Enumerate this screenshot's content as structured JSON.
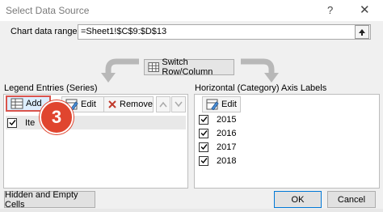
{
  "window": {
    "title": "Select Data Source",
    "help_glyph": "?",
    "close_glyph": "✕"
  },
  "range": {
    "label": "Chart data range:",
    "value": "=Sheet1!$C$9:$D$13"
  },
  "switch_label": "Switch Row/Column",
  "legend": {
    "title": "Legend Entries (Series)",
    "add_label": "Add",
    "edit_label": "Edit",
    "remove_label": "Remove",
    "items": [
      {
        "label": "Ite",
        "checked": true
      }
    ]
  },
  "axis": {
    "title": "Horizontal (Category) Axis Labels",
    "edit_label": "Edit",
    "items": [
      {
        "label": "2015",
        "checked": true
      },
      {
        "label": "2016",
        "checked": true
      },
      {
        "label": "2017",
        "checked": true
      },
      {
        "label": "2018",
        "checked": true
      }
    ]
  },
  "step_number": "3",
  "footer": {
    "hidden_cells_label": "Hidden and Empty Cells",
    "ok_label": "OK",
    "cancel_label": "Cancel"
  },
  "colors": {
    "badge": "#e0452f",
    "highlight": "#d9544d"
  }
}
